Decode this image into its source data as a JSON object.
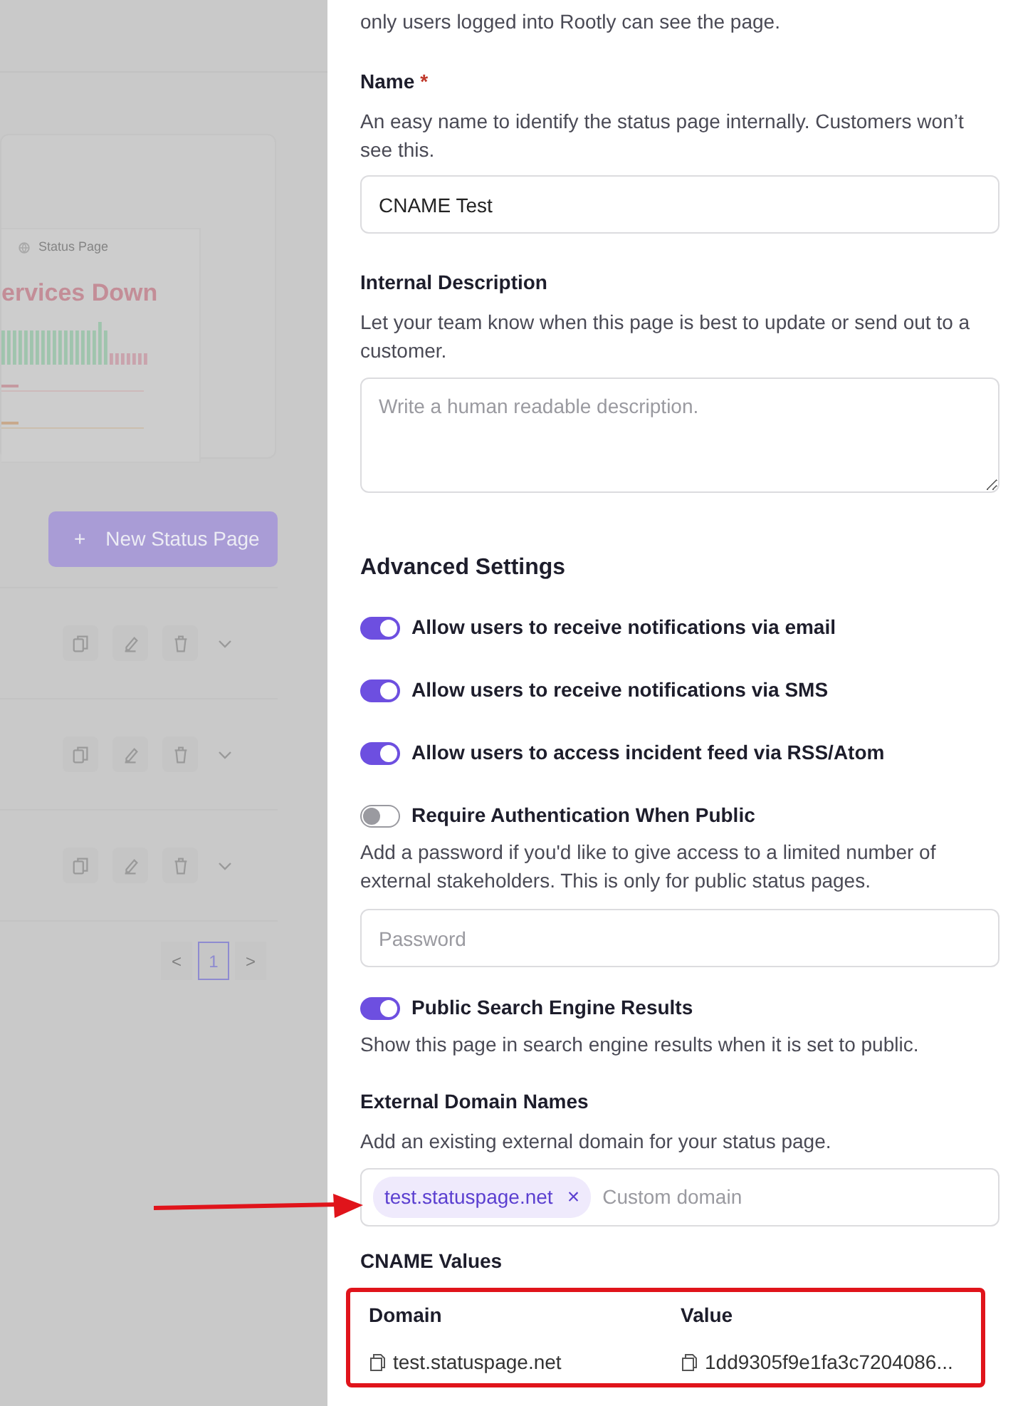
{
  "backdrop": {
    "preview": {
      "brand": "Status Page",
      "headline": "ervices Down"
    },
    "new_button": {
      "icon": "+",
      "label": "New Status Page"
    },
    "pagination": [
      {
        "label": "<",
        "selected": false
      },
      {
        "label": "1",
        "selected": true
      },
      {
        "label": ">",
        "selected": false
      }
    ]
  },
  "form": [
    {
      "kind": "intro",
      "text": "only users logged into Rootly can see the page."
    },
    {
      "kind": "field",
      "label": "Name",
      "required_mark": "*",
      "help": "An easy name to identify the status page internally. Customers won’t see this.",
      "value": "CNAME Test"
    },
    {
      "kind": "textarea",
      "label": "Internal Description",
      "help": "Let your team know when this page is best to update or send out to a customer.",
      "placeholder": "Write a human readable description."
    },
    {
      "kind": "heading",
      "text": "Advanced Settings"
    },
    {
      "kind": "toggle",
      "label": "Allow users to receive notifications via email",
      "on": true
    },
    {
      "kind": "toggle",
      "label": "Allow users to receive notifications via SMS",
      "on": true
    },
    {
      "kind": "toggle",
      "label": "Allow users to access incident feed via RSS/Atom",
      "on": true
    },
    {
      "kind": "toggle",
      "label": "Require Authentication When Public",
      "on": false,
      "help": "Add a password if you'd like to give access to a limited number of external stakeholders. This is only for public status pages.",
      "placeholder": "Password"
    },
    {
      "kind": "toggle",
      "label": "Public Search Engine Results",
      "on": true,
      "help": "Show this page in search engine results when it is set to public."
    },
    {
      "kind": "tags",
      "label": "External Domain Names",
      "help": "Add an existing external domain for your status page.",
      "tags": [
        {
          "text": "test.statuspage.net",
          "remove": "×"
        }
      ],
      "placeholder": "Custom domain"
    },
    {
      "kind": "table",
      "label": "CNAME Values",
      "columns": [
        "Domain",
        "Value"
      ],
      "rows": [
        [
          "test.statuspage.net",
          "1dd9305f9e1fa3c7204086..."
        ]
      ]
    }
  ]
}
